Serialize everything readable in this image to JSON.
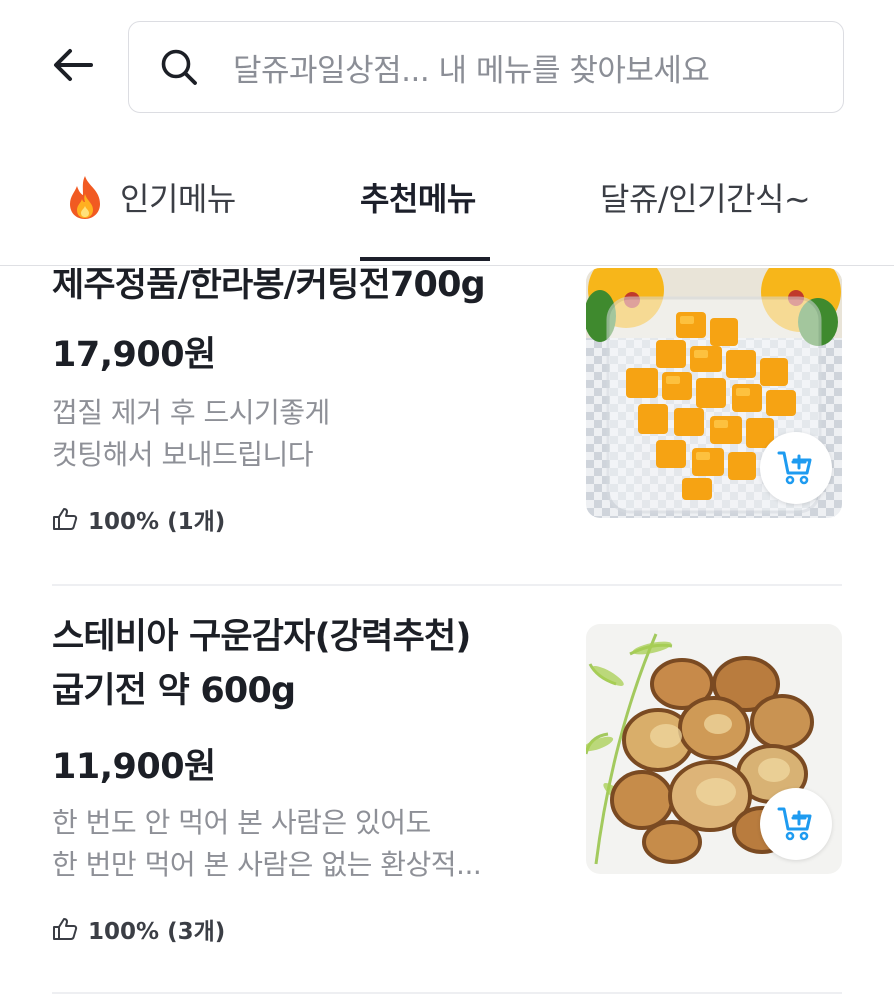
{
  "search": {
    "placeholder": "달쥬과일상점...  내 메뉴를 찾아보세요"
  },
  "tabs": [
    {
      "label": "인기메뉴",
      "icon": "fire-icon",
      "active": false
    },
    {
      "label": "추천메뉴",
      "active": true
    },
    {
      "label": "달쥬/인기간식~",
      "active": false
    }
  ],
  "menu_items": [
    {
      "title": "제주정품/한라봉/커팅전700g",
      "price": "17,900원",
      "description": [
        "껍질 제거 후 드시기좋게",
        "컷팅해서 보내드립니다"
      ],
      "rating": "100% (1개)",
      "image": "cut-hallabong-oranges"
    },
    {
      "title_lines": [
        "스테비아 구운감자(강력추천)",
        "굽기전 약 600g"
      ],
      "price": "11,900원",
      "description": [
        "한 번도 안 먹어 본 사람은 있어도",
        "한 번만 먹어 본 사람은 없는 환상적..."
      ],
      "rating": "100% (3개)",
      "image": "roasted-sweet-potato-slices"
    }
  ],
  "colors": {
    "text_primary": "#1c1f26",
    "text_secondary": "#8e9097",
    "accent_cart": "#1e9bf0",
    "divider": "#eeeff2"
  }
}
